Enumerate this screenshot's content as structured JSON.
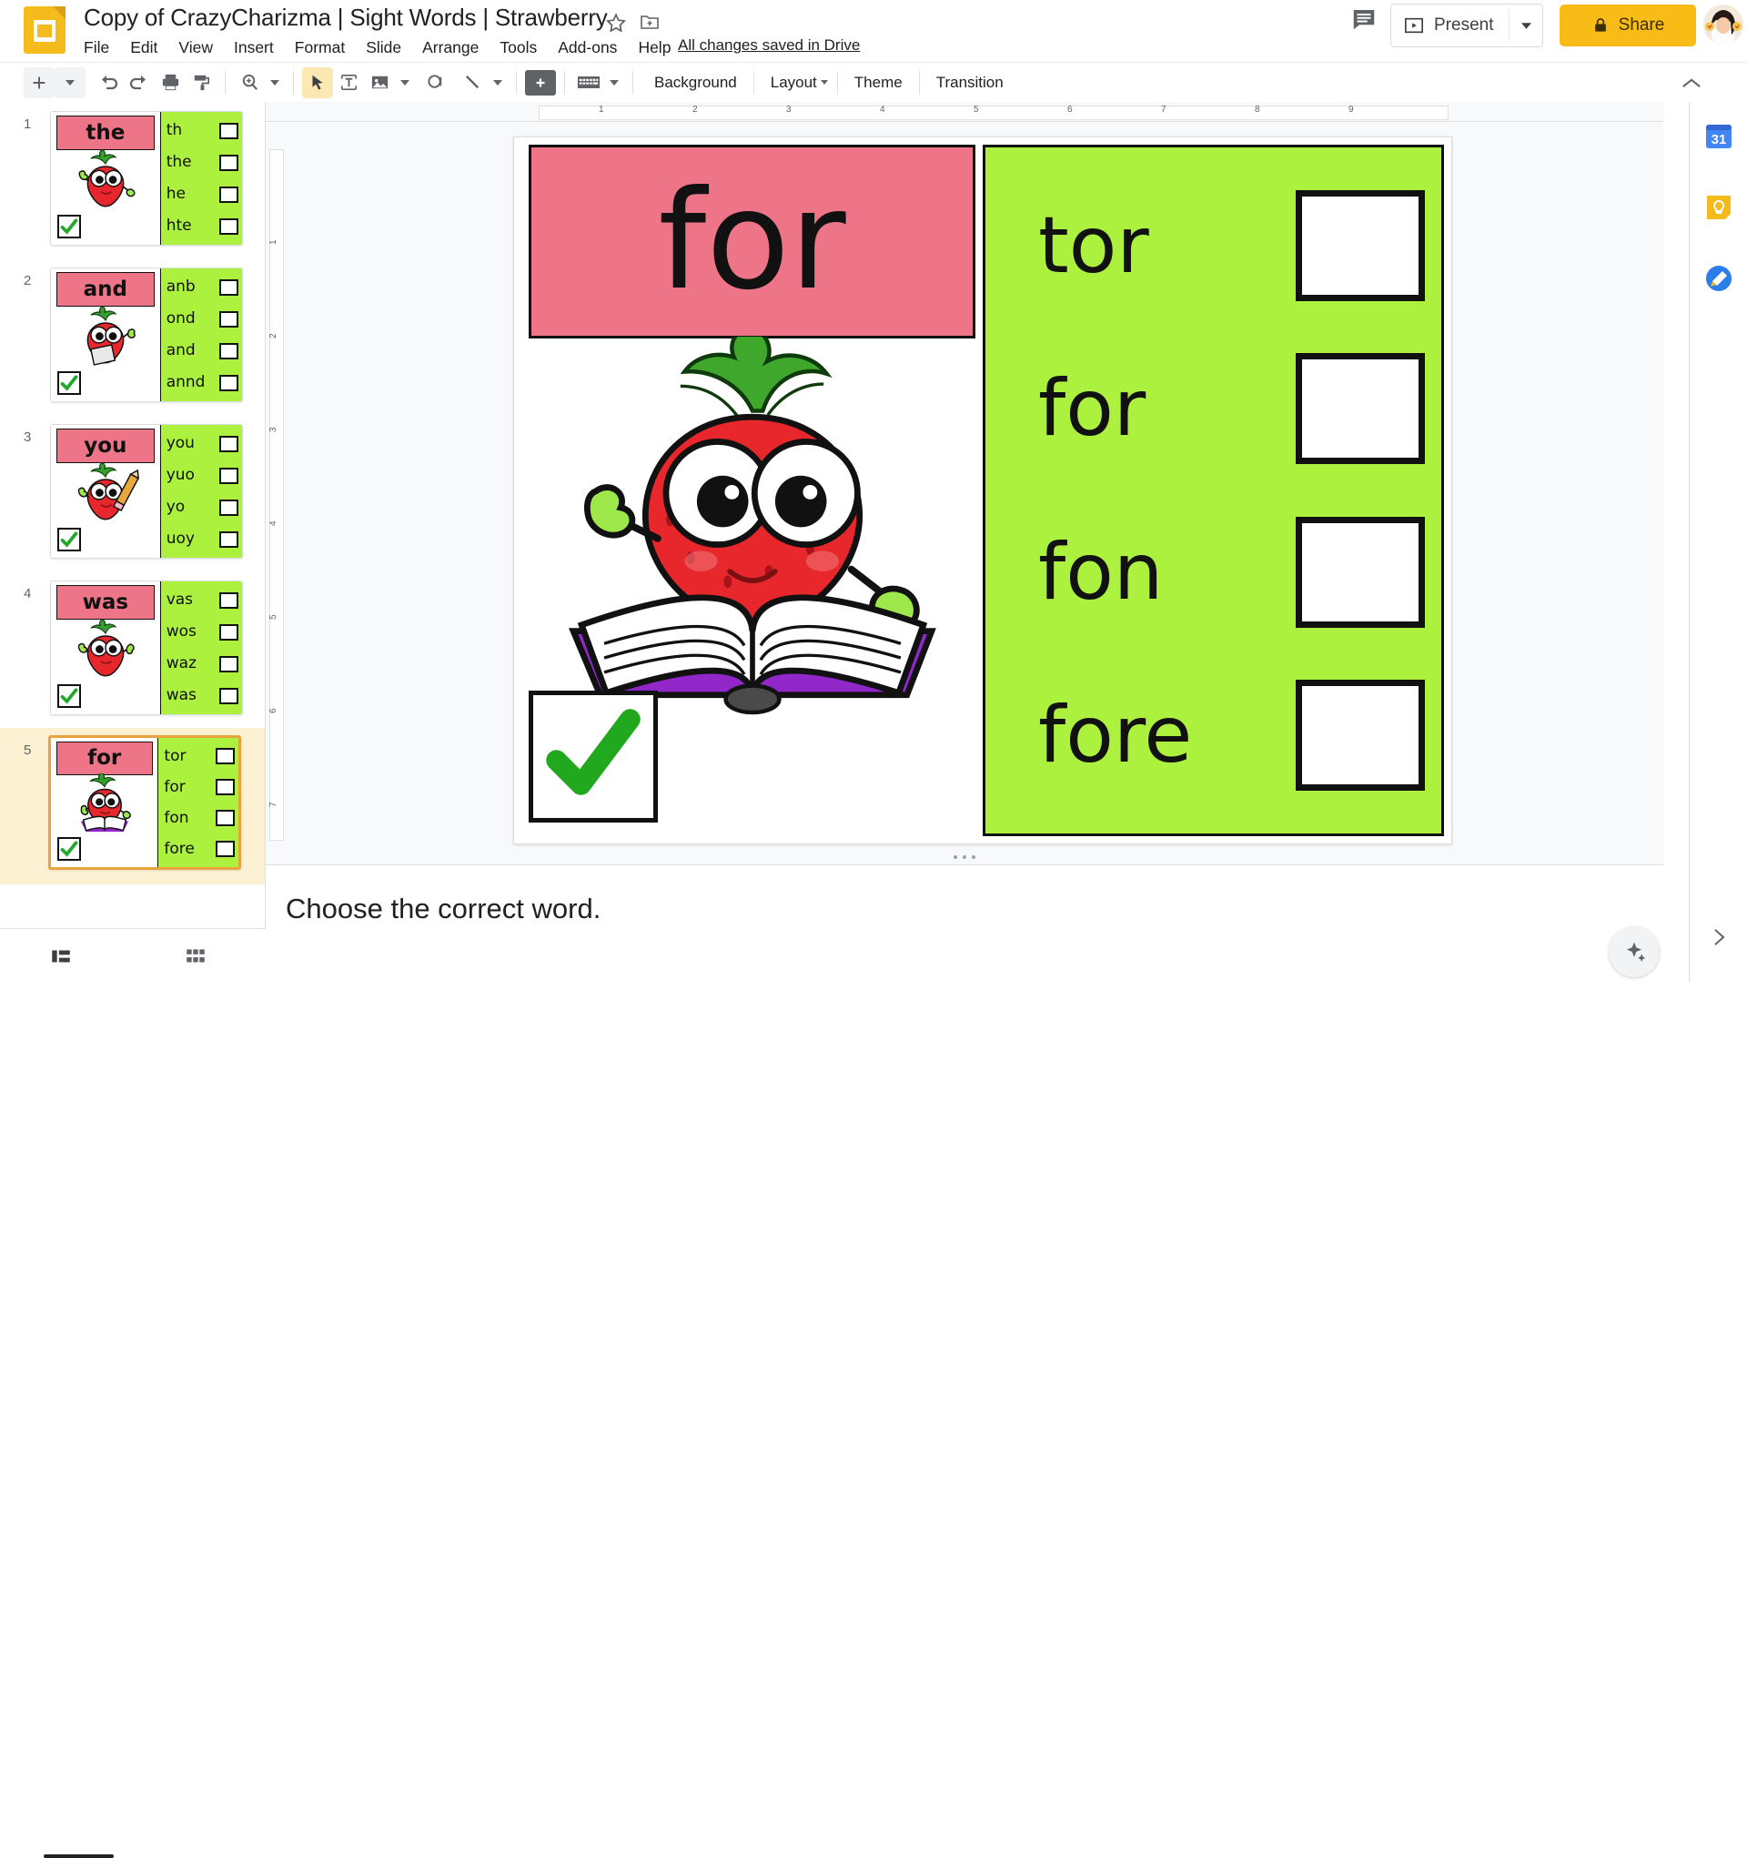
{
  "app": {
    "doc_title": "Copy of CrazyCharizma | Sight Words | Strawberry",
    "save_status": "All changes saved in Drive",
    "star_icon": "star-icon",
    "move_icon": "move-to-folder-icon",
    "doc_icon": "slides-doc-icon"
  },
  "menus": [
    {
      "label": "File"
    },
    {
      "label": "Edit"
    },
    {
      "label": "View"
    },
    {
      "label": "Insert"
    },
    {
      "label": "Format"
    },
    {
      "label": "Slide"
    },
    {
      "label": "Arrange"
    },
    {
      "label": "Tools"
    },
    {
      "label": "Add-ons"
    },
    {
      "label": "Help"
    }
  ],
  "header_actions": {
    "comment_icon": "comment-history-icon",
    "present_label": "Present",
    "present_icon": "present-play-icon",
    "present_caret": "chevron-down-icon",
    "share_label": "Share",
    "share_lock_icon": "lock-icon",
    "avatar": "user-avatar",
    "share_color": "#F9BB15"
  },
  "toolbar": {
    "items": [
      {
        "name": "new-slide-button",
        "icon": "plus-icon"
      },
      {
        "name": "new-slide-dropdown",
        "icon": "chevron-down-icon"
      },
      {
        "name": "undo-button",
        "icon": "undo-icon"
      },
      {
        "name": "redo-button",
        "icon": "redo-icon"
      },
      {
        "name": "print-button",
        "icon": "printer-icon"
      },
      {
        "name": "paint-format-button",
        "icon": "paint-format-icon"
      },
      {
        "name": "zoom-button",
        "icon": "zoom-icon"
      },
      {
        "name": "zoom-dropdown",
        "icon": "chevron-down-icon"
      },
      {
        "name": "select-tool-button",
        "icon": "cursor-arrow-icon"
      },
      {
        "name": "text-box-button",
        "icon": "text-box-icon"
      },
      {
        "name": "insert-image-button",
        "icon": "image-icon"
      },
      {
        "name": "insert-image-dropdown",
        "icon": "chevron-down-icon"
      },
      {
        "name": "shape-button",
        "icon": "shape-icon"
      },
      {
        "name": "line-button",
        "icon": "line-icon"
      },
      {
        "name": "line-dropdown",
        "icon": "chevron-down-icon"
      },
      {
        "name": "add-comment-button",
        "icon": "add-comment-icon"
      },
      {
        "name": "transition-tool-button",
        "icon": "keyboard-icon"
      },
      {
        "name": "transition-tool-dropdown",
        "icon": "chevron-down-icon"
      }
    ],
    "background_label": "Background",
    "layout_label": "Layout",
    "theme_label": "Theme",
    "transition_label": "Transition",
    "collapse_icon": "chevron-up-icon"
  },
  "ruler": {
    "h_ticks": [
      "1",
      "2",
      "3",
      "4",
      "5",
      "6",
      "7",
      "8",
      "9"
    ],
    "v_ticks": [
      "1",
      "2",
      "3",
      "4",
      "5",
      "6",
      "7"
    ]
  },
  "slides": [
    {
      "number": "1",
      "word": "the",
      "options": [
        "th",
        "the",
        "he",
        "hte"
      ],
      "selected": false
    },
    {
      "number": "2",
      "word": "and",
      "options": [
        "anb",
        "ond",
        "and",
        "annd"
      ],
      "selected": false
    },
    {
      "number": "3",
      "word": "you",
      "options": [
        "you",
        "yuo",
        "yo",
        "uoy"
      ],
      "selected": false
    },
    {
      "number": "4",
      "word": "was",
      "options": [
        "vas",
        "wos",
        "waz",
        "was"
      ],
      "selected": false
    },
    {
      "number": "5",
      "word": "for",
      "options": [
        "tor",
        "for",
        "fon",
        "fore"
      ],
      "selected": true
    }
  ],
  "current_slide": {
    "word": "for",
    "options": [
      "tor",
      "for",
      "fon",
      "fore"
    ],
    "word_bg": "#EE7487",
    "options_bg": "#ACF13E",
    "check_icon": "green-checkmark-icon",
    "illustration": "strawberry-character-reading-book"
  },
  "notes": {
    "text": "Choose the correct word."
  },
  "bottom_bar": {
    "filmstrip_icon": "filmstrip-view-icon",
    "grid_icon": "grid-view-icon"
  },
  "explore": {
    "icon": "explore-icon"
  },
  "rail": {
    "items": [
      {
        "name": "google-calendar-icon",
        "label": "31"
      },
      {
        "name": "google-keep-icon",
        "label": ""
      },
      {
        "name": "google-tasks-icon",
        "label": ""
      }
    ],
    "expand_icon": "chevron-right-icon"
  }
}
